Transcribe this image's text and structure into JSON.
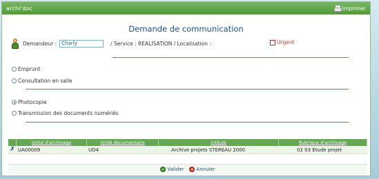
{
  "window": {
    "app_title": "archi'doc",
    "print_label": "Imprimer"
  },
  "form": {
    "heading": "Demande de communication",
    "requester_label": "Demandeur :",
    "requester_value": "Charly",
    "service_text": "/ Service : REALISATION / Localisation :",
    "urgent_label": "Urgent",
    "urgent_checked": false
  },
  "options_group1": [
    {
      "label": "Emprunt",
      "checked": false
    },
    {
      "label": "Consultation en salle",
      "checked": false
    }
  ],
  "options_group2": [
    {
      "label": "Photocopie",
      "checked": true
    },
    {
      "label": "Transmission des documents numériés",
      "checked": false
    }
  ],
  "table": {
    "headers": [
      "Unité d'archivage",
      "Unité documentaire",
      "Intitulé",
      "Rubrique d'archivage"
    ],
    "rows": [
      [
        "UA00009",
        "UD4",
        "Archive projets STEREAU 2000",
        "02 03 Etude projet"
      ]
    ]
  },
  "actions": {
    "validate_label": "Valider",
    "cancel_label": "Annuler"
  },
  "colors": {
    "titlebar": "#4e9a3a",
    "heading": "#1d4f8c",
    "urgent": "#d23a2a"
  }
}
